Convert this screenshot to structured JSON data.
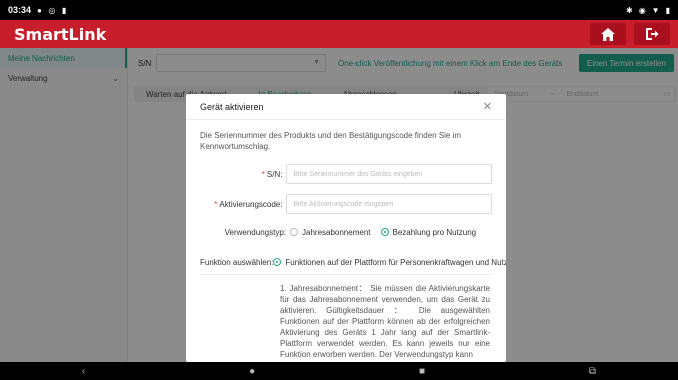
{
  "status_bar": {
    "time": "03:34",
    "left_icons": [
      "location-icon",
      "app-icon",
      "storage-icon"
    ],
    "right_icons": [
      "bluetooth-icon",
      "location-icon",
      "wifi-icon",
      "battery-icon"
    ]
  },
  "header": {
    "brand": "SmartLink",
    "home_icon": "home-icon",
    "logout_icon": "logout-icon"
  },
  "sidebar": {
    "items": [
      {
        "label": "Meine Nachrichten"
      },
      {
        "label": "Verwaltung"
      }
    ]
  },
  "toolbar": {
    "sn_label": "S/N",
    "oneclick_text": "One-click Veröffentlichung mit einem Klick am Ende des Geräts",
    "create_button": "Einen Termin erstellen"
  },
  "tabs": {
    "items": [
      "Warten auf die Antwort",
      "In Bearbeitung",
      "Abgeschlossen"
    ],
    "time_label": "Uhrzeit",
    "start_date_placeholder": "Startdatum",
    "separator": "~",
    "end_date_placeholder": "Enddatum"
  },
  "modal": {
    "title": "Gerät aktivieren",
    "description": "Die Seriennummer des Produkts und den Bestätigungscode finden Sie im Kennwortumschlag.",
    "sn_label": "S/N:",
    "sn_placeholder": "Bitte Seriennummer des Geräts eingeben",
    "code_label": "Aktivierungscode:",
    "code_placeholder": "Bitte Aktivierungscode eingeben",
    "usage_label": "Verwendungstyp:",
    "usage_options": [
      "Jahresabonnement",
      "Bezahlung pro Nutzung"
    ],
    "function_label": "Funktion auswählen:",
    "function_option": "Funktionen auf der Plattform für Personenkraftwagen und Nutzfahrzeuge",
    "long_text": "1. Jahresabonnement： Sie müssen die Aktivierungskarte für das Jahresabonnement verwenden, um das Gerät zu aktivieren. Gültigkeitsdauer ： Die ausgewählten Funktionen auf der Plattform können ab der erfolgreichen Aktivierung des Geräts 1 Jahr lang auf der Smartlink-Plattform verwendet werden. Es kann jeweils nur eine Funktion erworben werden. Der Verwendungstyp kann"
  },
  "colors": {
    "brand_red": "#c81e2c",
    "accent_green": "#22a98a"
  }
}
